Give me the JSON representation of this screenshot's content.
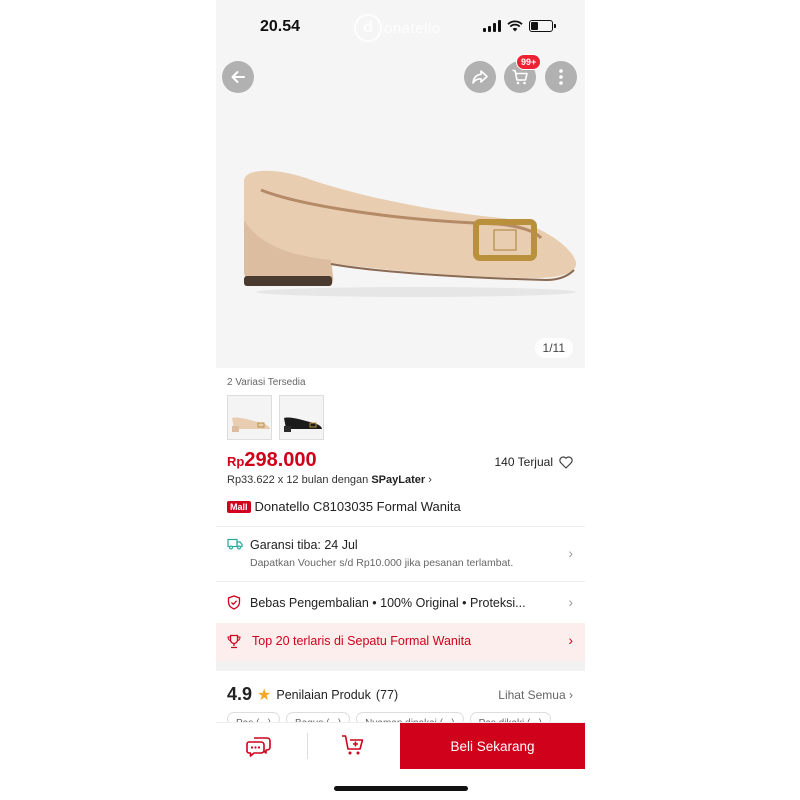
{
  "status_bar": {
    "time": "20.54"
  },
  "watermark": {
    "mark": "d",
    "text": "onatello"
  },
  "top_bar": {
    "cart_badge": "99+"
  },
  "gallery": {
    "counter": "1/11"
  },
  "variants": {
    "label": "2 Variasi Tersedia"
  },
  "price": {
    "currency": "Rp",
    "amount": "298.000"
  },
  "sold": {
    "text": "140 Terjual"
  },
  "installment": {
    "text": "Rp33.622 x 12 bulan dengan ",
    "brand": "SPayLater",
    "arrow": "›"
  },
  "product": {
    "badge": "Mall",
    "title": "Donatello C8103035 Formal Wanita"
  },
  "shipping": {
    "title": "Garansi tiba: 24 Jul",
    "subtitle": "Dapatkan Voucher s/d Rp10.000 jika pesanan terlambat."
  },
  "guarantee": {
    "text": "Bebas Pengembalian  •  100% Original  •  Proteksi..."
  },
  "top_rank": {
    "text": "Top 20 terlaris di Sepatu Formal Wanita"
  },
  "rating": {
    "score": "4.9",
    "star": "★",
    "label": "Penilaian Produk",
    "count": "(77)",
    "see_all": "Lihat Semua"
  },
  "review_chips": [
    "Pas (...)",
    "Bagus (...)",
    "Nyaman dipakai (...)",
    "Pas dikaki (...)"
  ],
  "bottom_bar": {
    "buy_label": "Beli Sekarang"
  },
  "colors": {
    "brand_red": "#d0011b",
    "badge_red": "#ee2233",
    "shoe_beige": "#e8cdb0",
    "star": "#f5a623"
  },
  "icons": [
    "back-arrow-icon",
    "share-icon",
    "cart-icon",
    "more-icon",
    "heart-icon",
    "truck-icon",
    "shield-icon",
    "trophy-icon",
    "chat-icon",
    "add-to-cart-icon"
  ]
}
